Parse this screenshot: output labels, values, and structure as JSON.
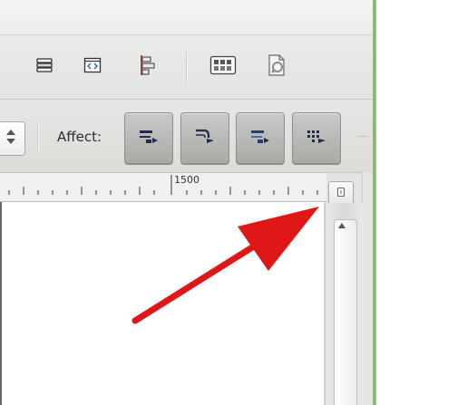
{
  "toolbar": {
    "icons": [
      {
        "name": "layers-icon"
      },
      {
        "name": "xml-editor-icon"
      },
      {
        "name": "align-distribute-icon"
      },
      {
        "name": "object-properties-icon"
      },
      {
        "name": "document-properties-icon"
      }
    ]
  },
  "affect": {
    "label": "Affect:",
    "buttons": [
      {
        "name": "scale-stroke-width-button"
      },
      {
        "name": "scale-rounded-corners-button"
      },
      {
        "name": "move-gradients-button"
      },
      {
        "name": "move-patterns-button"
      }
    ]
  },
  "ruler": {
    "label": "1500"
  },
  "annotation": {
    "arrow_color": "#e01717"
  }
}
